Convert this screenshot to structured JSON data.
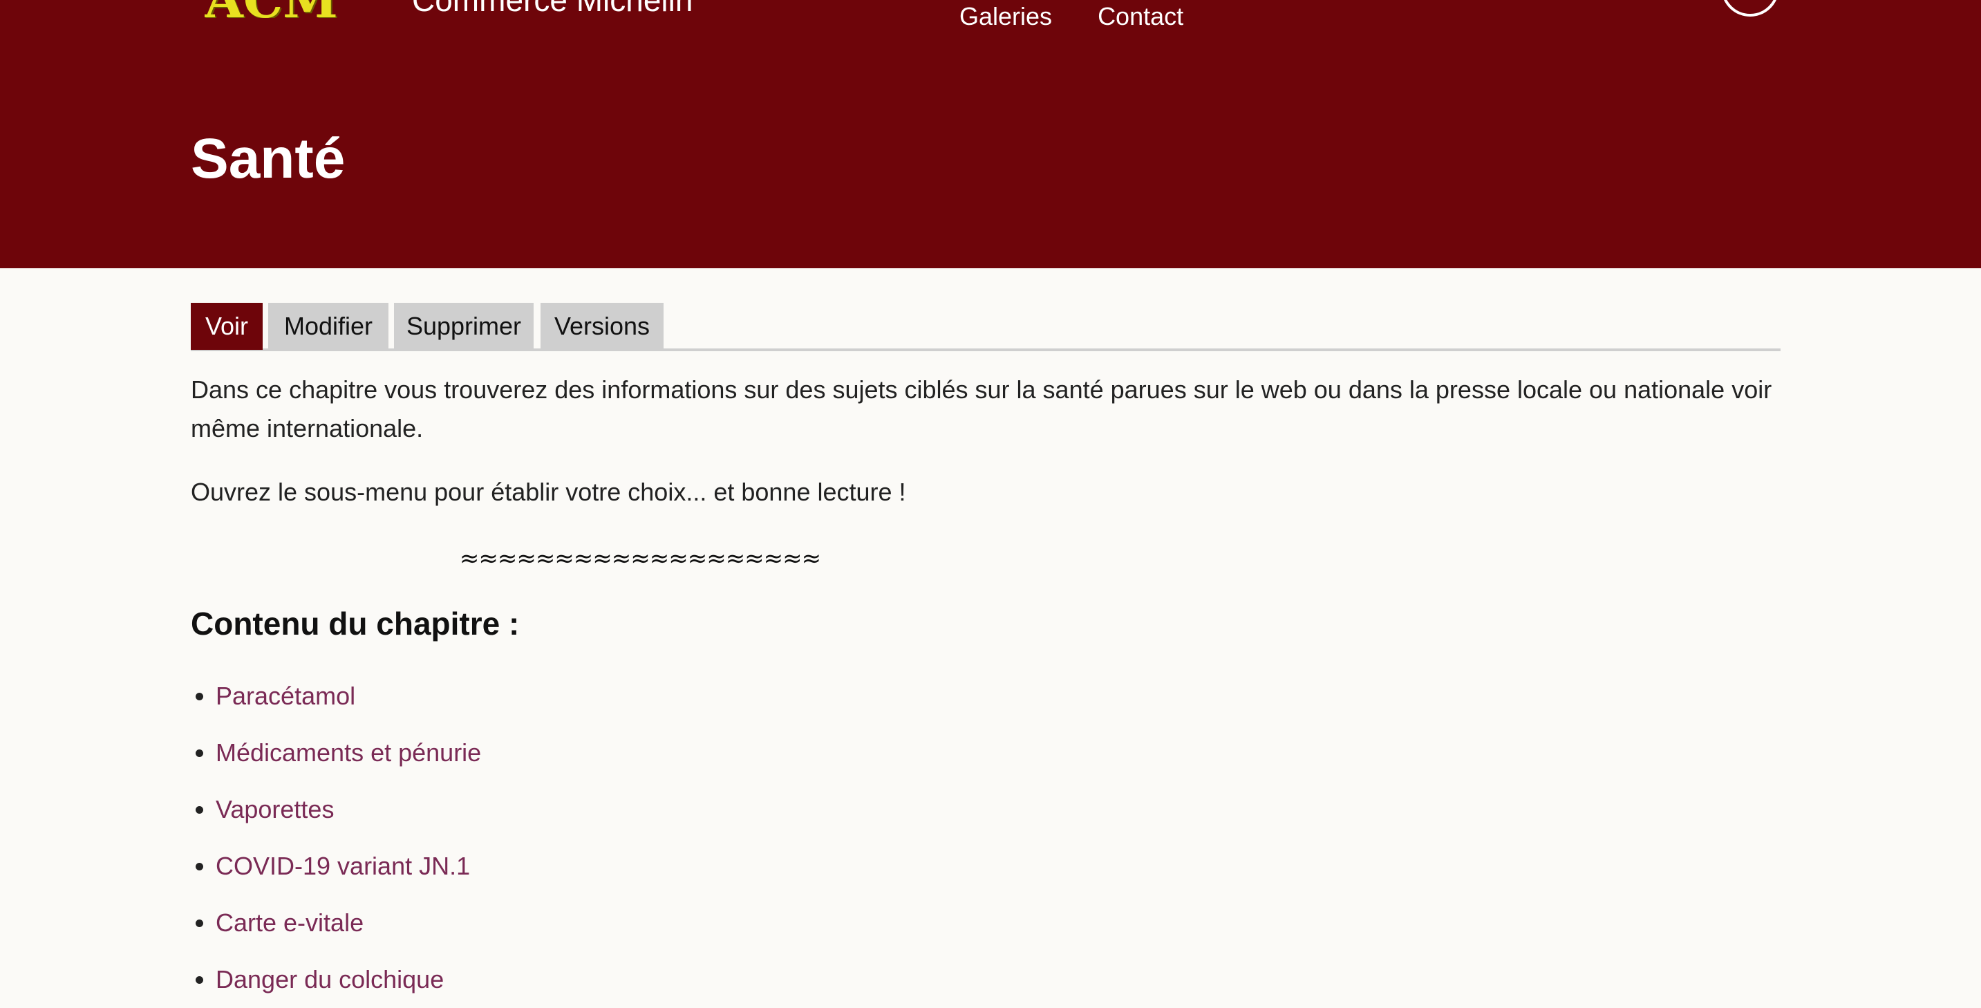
{
  "header": {
    "logo_text": "ACM",
    "site_name": "Commerce Michelin",
    "nav": [
      "Galeries",
      "Contact"
    ],
    "page_title": "Santé"
  },
  "tabs": [
    "Voir",
    "Modifier",
    "Supprimer",
    "Versions"
  ],
  "active_tab": "Voir",
  "content": {
    "paragraph1": "Dans ce chapitre vous trouverez des informations sur des sujets ciblés sur la santé parues sur le web ou dans la presse locale ou nationale voir même internationale.",
    "paragraph2": "Ouvrez le sous-menu pour établir votre choix... et bonne lecture !",
    "separator": "≈≈≈≈≈≈≈≈≈≈≈≈≈≈≈≈≈≈≈",
    "section_title": "Contenu du chapitre :",
    "items": [
      "Paracétamol",
      "Médicaments et pénurie",
      "Vaporettes",
      "COVID-19 variant JN.1",
      "Carte e-vitale",
      "Danger du colchique"
    ]
  },
  "colors": {
    "header_bg": "#6e050a",
    "page_bg": "#fbfaf7",
    "link": "#7a2a55",
    "tab_inactive": "#cfcfcf"
  },
  "icons": {
    "search": "search-icon"
  }
}
